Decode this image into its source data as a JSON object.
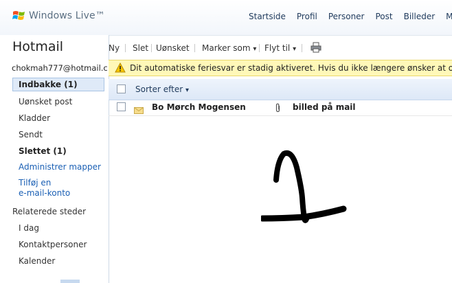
{
  "brand": {
    "logo_text": "Windows Live™"
  },
  "topnav": [
    "Startside",
    "Profil",
    "Personer",
    "Post",
    "Billeder",
    "M"
  ],
  "sidebar": {
    "title": "Hotmail",
    "account": "chokmah777@hotmail.c",
    "folders": {
      "inbox": "Indbakke (1)",
      "junk": "Uønsket post",
      "drafts": "Kladder",
      "sent": "Sendt",
      "deleted": "Slettet (1)",
      "manage": "Administrer mapper",
      "add_account_1": "Tilføj en",
      "add_account_2": "e-mail-konto"
    },
    "related_heading": "Relaterede steder",
    "related": {
      "today": "I dag",
      "contacts": "Kontaktpersoner",
      "calendar": "Kalender"
    }
  },
  "toolbar": {
    "new": "Ny",
    "delete": "Slet",
    "junk": "Uønsket",
    "mark_as": "Marker som",
    "move_to": "Flyt til",
    "dropdown_glyph": "▾"
  },
  "notice": {
    "text": "Dit automatiske feriesvar er stadig aktiveret. Hvis du ikke længere ønsker at orient"
  },
  "list": {
    "sort_label": "Sorter efter",
    "sort_glyph": "▾"
  },
  "messages": [
    {
      "sender": "Bo Mørch Mogensen",
      "subject": "billed på mail",
      "has_attachment": true,
      "unread": true
    }
  ],
  "colors": {
    "link": "#1a5fb4",
    "notice_bg": "#fff8b8",
    "selected_folder_bg": "#dfeaf8",
    "drawing_ink": "#000000"
  },
  "icons": [
    "windows-flag-icon",
    "printer-icon",
    "warning-icon",
    "envelope-icon",
    "paperclip-icon"
  ]
}
